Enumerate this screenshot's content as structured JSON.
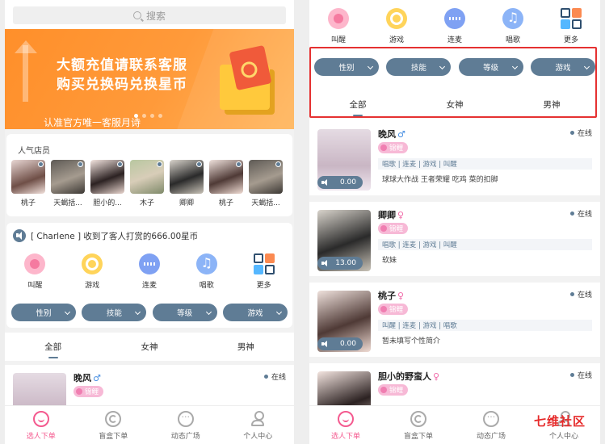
{
  "search": {
    "placeholder": "搜索"
  },
  "banner": {
    "line1": "大额充值请联系客服",
    "line2": "购买兑换码兑换星币",
    "line3": "认准官方唯一客服月诗"
  },
  "popular": {
    "title": "人气店员",
    "items": [
      {
        "name": "桃子"
      },
      {
        "name": "天蝎括..."
      },
      {
        "name": "胆小的..."
      },
      {
        "name": "木子"
      },
      {
        "name": "卿卿"
      },
      {
        "name": "桃子"
      },
      {
        "name": "天蝎括..."
      }
    ]
  },
  "notice": {
    "text": "[ Charlene ] 收到了客人打赏的666.00星币"
  },
  "categories": [
    {
      "label": "叫醒",
      "icon": "alarm-clock-icon"
    },
    {
      "label": "游戏",
      "icon": "game-icon"
    },
    {
      "label": "连麦",
      "icon": "voice-wave-icon"
    },
    {
      "label": "唱歌",
      "icon": "music-note-icon"
    },
    {
      "label": "更多",
      "icon": "grid-more-icon"
    }
  ],
  "filters": [
    "性别",
    "技能",
    "等级",
    "游戏"
  ],
  "tabs": [
    "全部",
    "女神",
    "男神"
  ],
  "status_online": "在线",
  "cards": [
    {
      "name": "晚风",
      "gender": "♂",
      "gender_color": "#4a90e2",
      "level": "锦鲤",
      "skills": "唱歌 | 连麦 | 游戏 | 叫醒",
      "bio": "球球大作战 王者荣耀 吃鸡 菜的扣脚",
      "duration": "0.00"
    },
    {
      "name": "卿卿",
      "gender": "♀",
      "gender_color": "#f06aa8",
      "level": "锦鲤",
      "skills": "唱歌 | 连麦 | 游戏 | 叫醒",
      "bio": "软妹",
      "duration": "13.00"
    },
    {
      "name": "桃子",
      "gender": "♀",
      "gender_color": "#f06aa8",
      "level": "锦鲤",
      "skills": "叫醒 | 连麦 | 游戏 | 唱歌",
      "bio": "暂未填写个性简介",
      "duration": "0.00"
    },
    {
      "name": "胆小的野蛮人",
      "gender": "♀",
      "gender_color": "#f06aa8",
      "level": "锦鲤",
      "skills": "",
      "bio": "",
      "duration": ""
    }
  ],
  "bottom_nav": [
    {
      "label": "选人下单",
      "icon": "heart-icon",
      "active": true
    },
    {
      "label": "盲盒下单",
      "icon": "blind-box-icon",
      "active": false
    },
    {
      "label": "动态广场",
      "icon": "chat-bubble-icon",
      "active": false
    },
    {
      "label": "个人中心",
      "icon": "user-icon",
      "active": false
    }
  ],
  "watermark": "七维社区",
  "colors": {
    "accent": "#5f7c95",
    "pink": "#f45a8f",
    "highlight": "#e53131",
    "banner": "#ff8f2a"
  }
}
